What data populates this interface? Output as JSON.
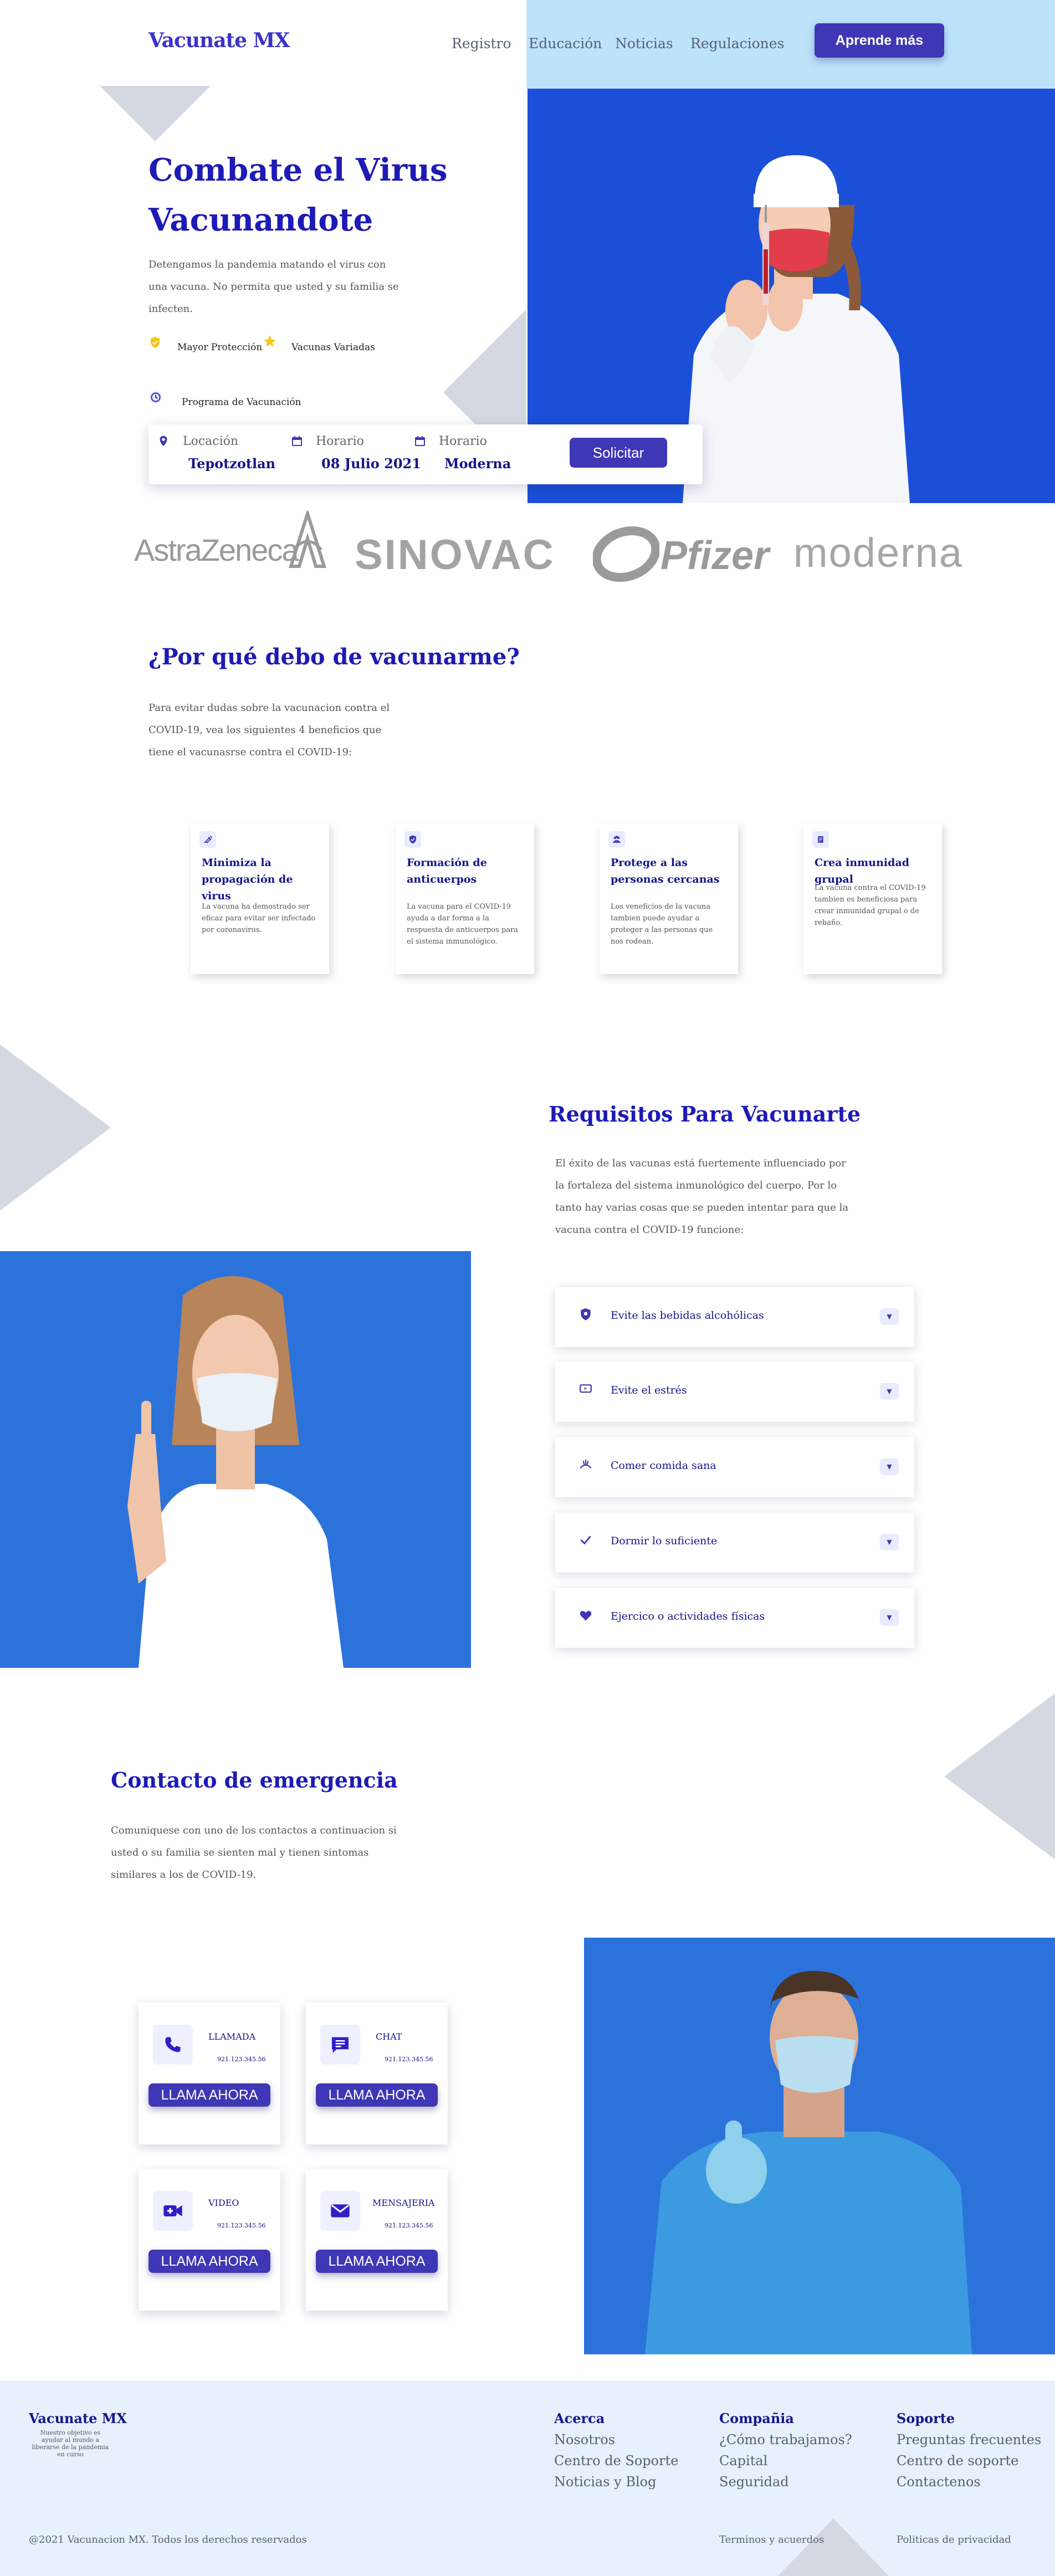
{
  "header": {
    "logo": "Vacunate MX",
    "nav": [
      "Registro",
      "Educación",
      "Noticias",
      "Regulaciones"
    ],
    "cta": "Aprende más"
  },
  "hero": {
    "title": "Combate el Virus Vacunandote",
    "description": "Detengamos la pandemia matando el virus con una vacuna. No permita que usted y su familia se infecten.",
    "features": [
      "Mayor Protección",
      "Vacunas Variadas",
      "Programa de Vacunación"
    ],
    "booking": {
      "location_label": "Locación",
      "location_value": "Tepotzotlan",
      "date_label": "Horario",
      "date_value": "08 Julio 2021",
      "vaccine_label": "Horario",
      "vaccine_value": "Moderna",
      "submit": "Solicitar"
    }
  },
  "brands": [
    "AstraZeneca",
    "SINOVAC",
    "Pfizer",
    "moderna"
  ],
  "why": {
    "title": "¿Por qué debo de vacunarme?",
    "text": "Para evitar dudas sobre la vacunacion contra el COVID-19, vea los siguientes 4 beneficios que tiene el vacunasrse contra el COVID-19:",
    "cards": [
      {
        "title": "Minimiza la propagación de virus",
        "text": "La vacuna ha demostrado ser eficaz para evitar ser infectado por coronavirus.",
        "icon": "syringe-icon"
      },
      {
        "title": "Formación de anticuerpos",
        "text": "La vacuna para el COVID-19 ayuda a dar forma a la respuesta de anticuerpos para el sistema inmunológico.",
        "icon": "shield-icon"
      },
      {
        "title": "Protege a las personas cercanas",
        "text": "Los veneficios de la vacuna tambien puede ayudar a proteger a las personas que nos rodean.",
        "icon": "people-icon"
      },
      {
        "title": "Crea inmunidad grupal",
        "text": "La vacuna contra el COVID-19 tambien es beneficiosa para crear inmunidad grupal o de rebaño.",
        "icon": "document-icon"
      }
    ]
  },
  "requirements": {
    "title": "Requisitos Para Vacunarte",
    "text": "El éxito de las vacunas está fuertemente influenciado por la fortaleza del sistema inmunológico del cuerpo. Por lo tanto hay varias cosas que se pueden intentar para que la vacuna contra el COVID-19 funcione:",
    "items": [
      {
        "label": "Evite las bebidas alcohólicas",
        "icon": "shield-icon"
      },
      {
        "label": "Evite el estrés",
        "icon": "monitor-icon"
      },
      {
        "label": "Comer comida sana",
        "icon": "food-icon"
      },
      {
        "label": "Dormir lo suficiente",
        "icon": "check-icon"
      },
      {
        "label": "Ejercico o actividades físicas",
        "icon": "heart-icon"
      }
    ]
  },
  "contact": {
    "title": "Contacto de emergencia",
    "text": "Comuniquese con uno de los contactos a continuacion si usted o su familia se sienten mal y tienen sintomas similares a los de COVID-19.",
    "cards": [
      {
        "label": "LLAMADA",
        "number": "921.123.345.56",
        "button": "LLAMA AHORA",
        "icon": "phone-icon"
      },
      {
        "label": "CHAT",
        "number": "921.123.345.56",
        "button": "LLAMA AHORA",
        "icon": "chat-icon"
      },
      {
        "label": "VIDEO",
        "number": "921.123.345.56",
        "button": "LLAMA AHORA",
        "icon": "video-icon"
      },
      {
        "label": "MENSAJERIA",
        "number": "921.123.345.56",
        "button": "LLAMA AHORA",
        "icon": "mail-icon"
      }
    ]
  },
  "footer": {
    "logo": "Vacunate MX",
    "tagline": "Nuestro objetivo es ayudar al mundo a liberarse de la pandemia en curso",
    "columns": [
      {
        "title": "Acerca",
        "links": [
          "Nosotros",
          "Centro de Soporte",
          "Noticias y Blog"
        ]
      },
      {
        "title": "Compañia",
        "links": [
          "¿Cómo trabajamos?",
          "Capital",
          "Seguridad"
        ]
      },
      {
        "title": "Soporte",
        "links": [
          "Preguntas frecuentes",
          "Centro de soporte",
          "Contactenos"
        ]
      }
    ],
    "copyright": "@2021 Vacunacion MX. Todos los derechos reservados",
    "terms": "Terminos y acuerdos",
    "privacy": "Politicas de privacidad"
  },
  "colors": {
    "primary": "#3f37b5",
    "title": "#1d1ab5",
    "hero_bg": "#1b4fd8",
    "photo_bg": "#2b73db",
    "header_band": "#bde3fb",
    "footer_bg": "#e8f1fb"
  }
}
